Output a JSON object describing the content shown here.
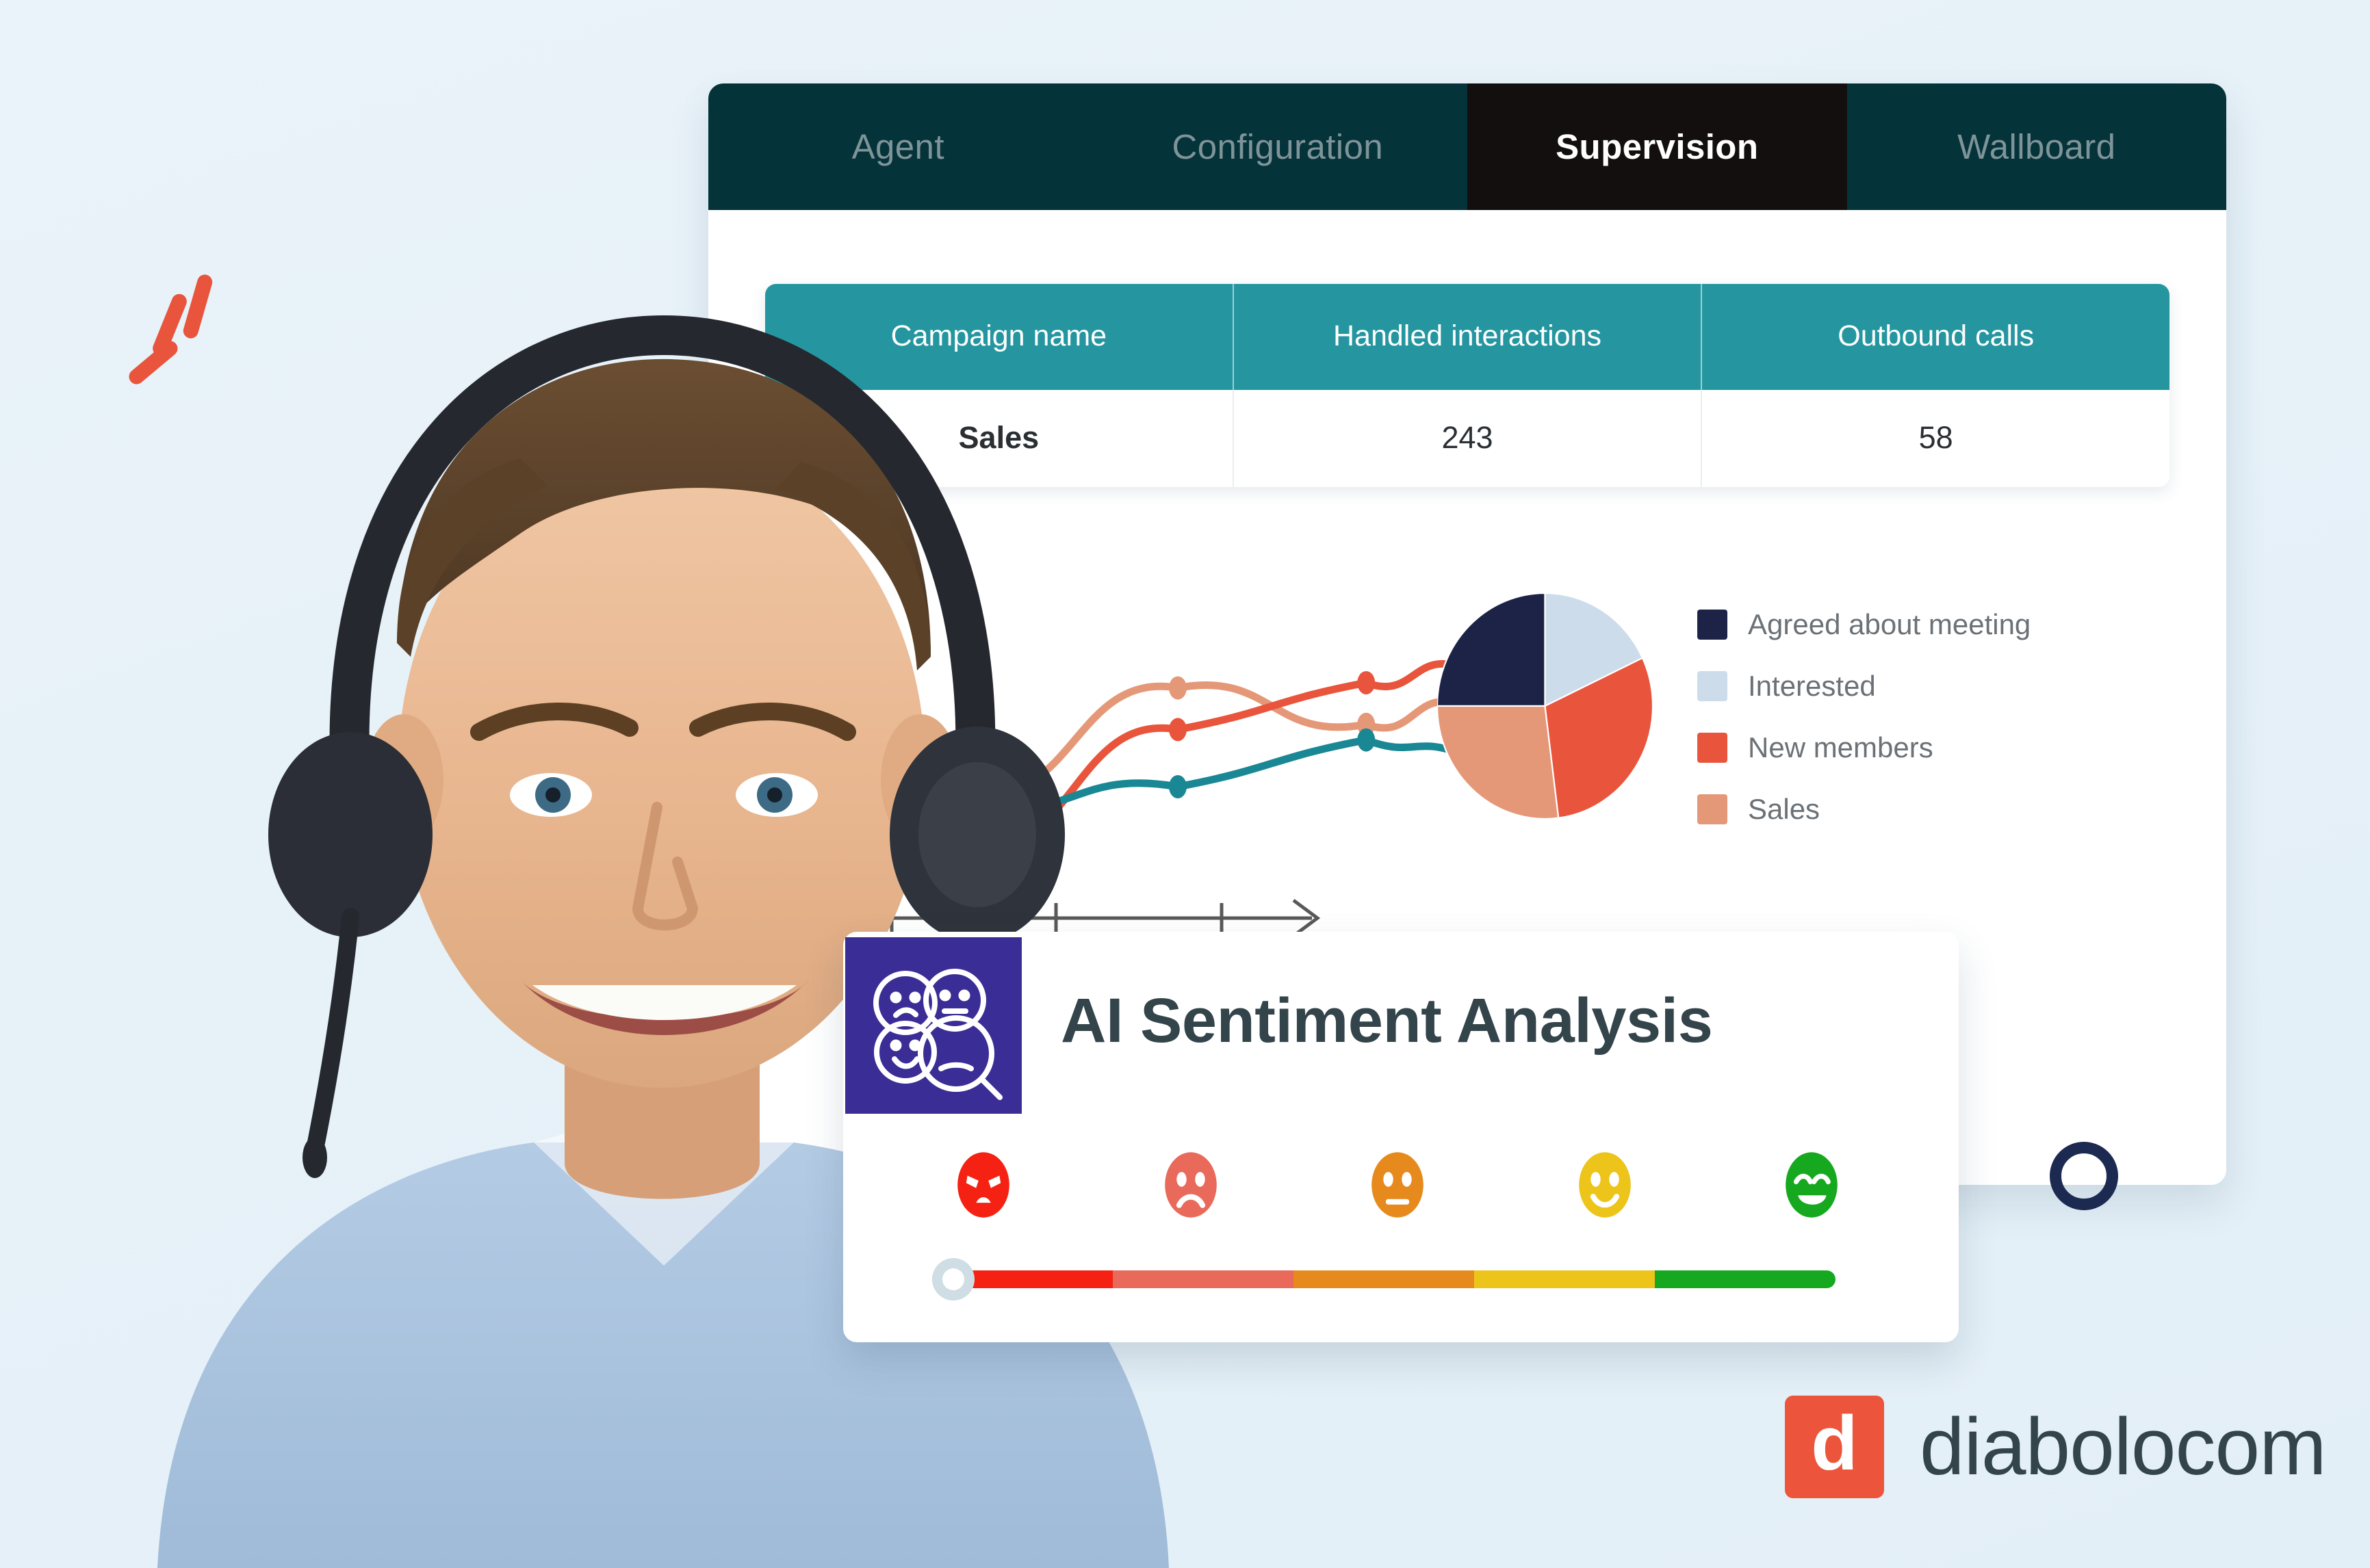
{
  "background": {
    "color": "#e8f2f8"
  },
  "decor": {
    "dashes_color": "#e8543c",
    "ring_color": "#1c2a52",
    "ring_name": "navy-ring"
  },
  "app": {
    "tabs": [
      {
        "label": "Agent",
        "active": false
      },
      {
        "label": "Configuration",
        "active": false
      },
      {
        "label": "Supervision",
        "active": true
      },
      {
        "label": "Wallboard",
        "active": false
      }
    ],
    "tabbar_color": "#05333a",
    "active_tab_color": "#130f0f"
  },
  "table": {
    "header_color": "#2596a0",
    "columns": [
      "Campaign name",
      "Handled interactions",
      "Outbound calls"
    ],
    "rows": [
      {
        "campaign_name": "Sales",
        "handled_interactions": "243",
        "outbound_calls": "58"
      }
    ]
  },
  "sentiment": {
    "title": "AI Sentiment Analysis",
    "badge_color": "#3a2d96",
    "badge_icon": "sentiment-faces-magnifier-icon",
    "faces": [
      {
        "name": "angry-face",
        "color": "#f52214"
      },
      {
        "name": "sad-face",
        "color": "#e9695a"
      },
      {
        "name": "neutral-face",
        "color": "#e68a1e"
      },
      {
        "name": "happy-face",
        "color": "#edc41a"
      },
      {
        "name": "very-happy-face",
        "color": "#16a81e"
      }
    ],
    "slider": {
      "segments": [
        "#f52214",
        "#e9695a",
        "#e68a1e",
        "#edc41a",
        "#16a81e"
      ],
      "thumb_position_percent": 78,
      "thumb_color": "#ffffff",
      "thumb_ring_color": "#cfdde4"
    }
  },
  "logo": {
    "mark_letter": "d",
    "mark_color": "#ec553c",
    "text": "diabolocom",
    "text_color": "#33444a"
  },
  "chart_data": [
    {
      "type": "pie",
      "title": "",
      "labels": [
        "Agreed about meeting",
        "Interested",
        "New members",
        "Sales"
      ],
      "values": [
        25,
        18,
        30,
        27
      ],
      "colors": [
        "#1c2346",
        "#ccdceb",
        "#e9543c",
        "#e59878"
      ],
      "legend_position": "right",
      "legend_text_color": "#6b7176"
    },
    {
      "type": "line",
      "title": "",
      "xlabel": "",
      "ylabel": "",
      "grid": false,
      "axis_color": "#595959",
      "x_ticks": [
        "",
        "",
        "",
        ""
      ],
      "series": [
        {
          "name": "series-salmon",
          "color": "#e59878",
          "x": [
            0,
            25,
            60,
            92
          ],
          "values": [
            72,
            38,
            78,
            64
          ]
        },
        {
          "name": "series-red",
          "color": "#e9543c",
          "x": [
            0,
            25,
            60,
            92
          ],
          "values": [
            22,
            18,
            62,
            80
          ]
        },
        {
          "name": "series-teal",
          "color": "#1a8794",
          "x": [
            0,
            25,
            60,
            92
          ],
          "values": [
            50,
            33,
            40,
            58
          ]
        }
      ]
    }
  ]
}
